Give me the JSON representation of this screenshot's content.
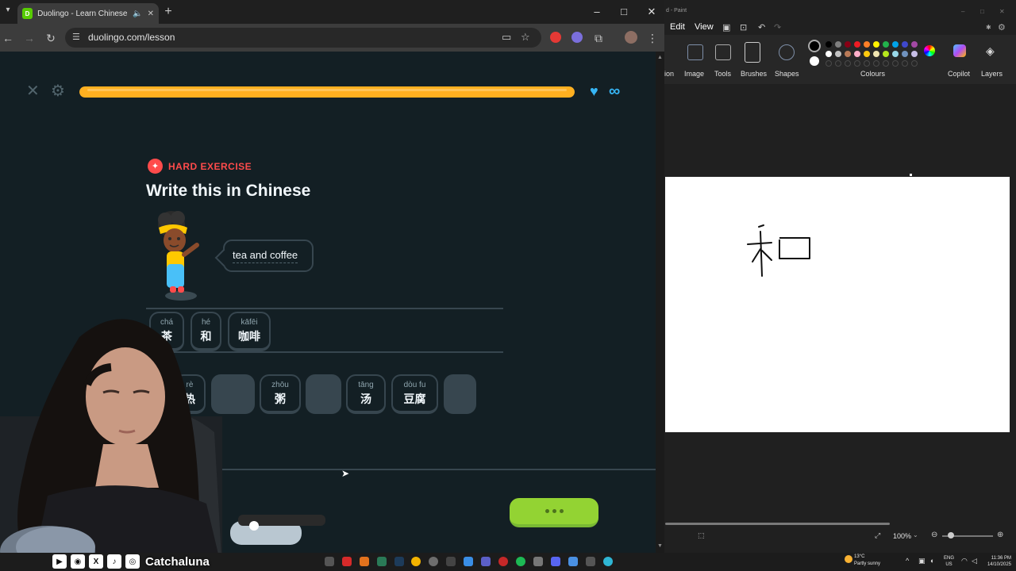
{
  "browser": {
    "tab_title": "Duolingo - Learn Chinese with lessons that...",
    "favicon_text": "D",
    "url": "duolingo.com/lesson"
  },
  "lesson": {
    "progress_fraction": 1.0,
    "hearts": "∞",
    "badge": "HARD EXERCISE",
    "title": "Write this in Chinese",
    "prompt": "tea and coffee",
    "answer_tiles": [
      {
        "pinyin": "chá",
        "hanzi": "茶"
      },
      {
        "pinyin": "hé",
        "hanzi": "和"
      },
      {
        "pinyin": "kāfēi",
        "hanzi": "咖啡"
      }
    ],
    "bank_tiles": [
      {
        "pinyin": "rè",
        "hanzi": "热",
        "empty": false
      },
      {
        "pinyin": "",
        "hanzi": "",
        "empty": true
      },
      {
        "pinyin": "zhōu",
        "hanzi": "粥",
        "empty": false
      },
      {
        "pinyin": "",
        "hanzi": "",
        "empty": true
      },
      {
        "pinyin": "tāng",
        "hanzi": "汤",
        "empty": false
      },
      {
        "pinyin": "dòu fu",
        "hanzi": "豆腐",
        "empty": false
      },
      {
        "pinyin": "",
        "hanzi": "",
        "empty": true
      }
    ]
  },
  "paint": {
    "title": "d - Paint",
    "menu": [
      "Edit",
      "View"
    ],
    "ribbon_groups": [
      "ion",
      "Image",
      "Tools",
      "Brushes",
      "Shapes",
      "Colours",
      "Copilot",
      "Layers"
    ],
    "zoom": "100%",
    "canvas_character": "和",
    "colors_row1": [
      "#000000",
      "#7f7f7f",
      "#880015",
      "#ed1c24",
      "#ff7f27",
      "#fff200",
      "#22b14c",
      "#00a2e8",
      "#3f48cc",
      "#a349a4"
    ],
    "colors_row2": [
      "#ffffff",
      "#c3c3c3",
      "#b97a57",
      "#ffaec9",
      "#ffc90e",
      "#efe4b0",
      "#b5e61d",
      "#99d9ea",
      "#7092be",
      "#c8bfe7"
    ]
  },
  "taskbar": {
    "weather_temp": "13°C",
    "weather_condition": "Partly sunny",
    "lang_top": "ENG",
    "lang_bottom": "US",
    "time": "11:36 PM",
    "date": "14/10/2025"
  },
  "overlay": {
    "handle": "Catchaluna"
  }
}
